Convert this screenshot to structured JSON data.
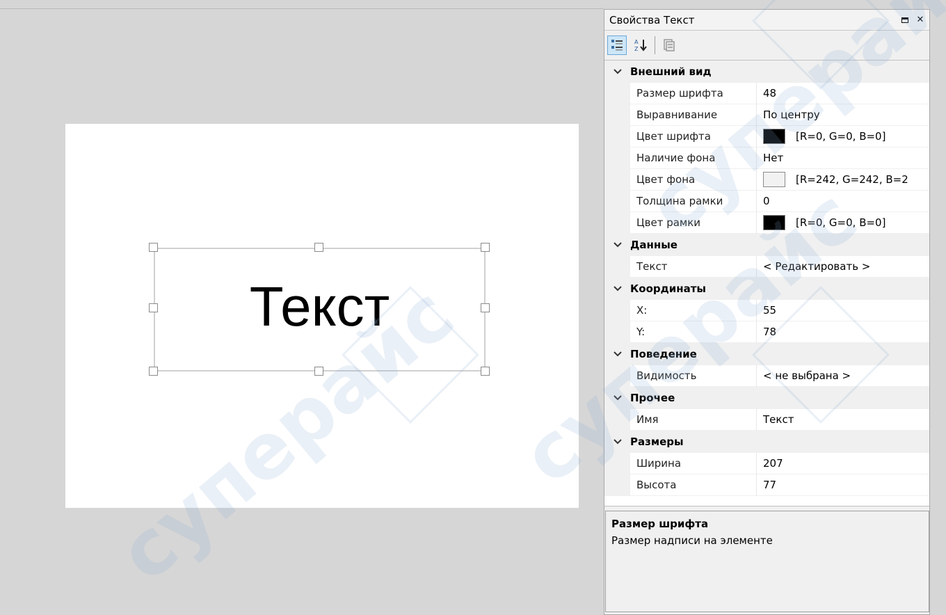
{
  "canvas": {
    "element_text": "Текст"
  },
  "panel": {
    "title": "Свойства Текст",
    "toolbar": {
      "categorized_icon": "categorized-view-icon",
      "alphabetical_icon": "sort-alpha-icon",
      "property_pages_icon": "property-pages-icon"
    },
    "categories": [
      {
        "label": "Внешний вид",
        "props": [
          {
            "name": "Размер шрифта",
            "value": "48"
          },
          {
            "name": "Выравнивание",
            "value": "По центру"
          },
          {
            "name": "Цвет шрифта",
            "value": "[R=0, G=0, B=0]",
            "swatch": "#000000"
          },
          {
            "name": "Наличие фона",
            "value": "Нет"
          },
          {
            "name": "Цвет фона",
            "value": "[R=242, G=242, B=2",
            "swatch": "#f2f2f2"
          },
          {
            "name": "Толщина рамки",
            "value": "0"
          },
          {
            "name": "Цвет рамки",
            "value": "[R=0, G=0, B=0]",
            "swatch": "#000000"
          }
        ]
      },
      {
        "label": "Данные",
        "props": [
          {
            "name": "Текст",
            "value": "< Редактировать >"
          }
        ]
      },
      {
        "label": "Координаты",
        "props": [
          {
            "name": "X:",
            "value": "55"
          },
          {
            "name": "Y:",
            "value": "78"
          }
        ]
      },
      {
        "label": "Поведение",
        "props": [
          {
            "name": "Видимость",
            "value": "< не выбрана >"
          }
        ]
      },
      {
        "label": "Прочее",
        "props": [
          {
            "name": "Имя",
            "value": "Текст"
          }
        ]
      },
      {
        "label": "Размеры",
        "props": [
          {
            "name": "Ширина",
            "value": "207"
          },
          {
            "name": "Высота",
            "value": "77"
          }
        ]
      }
    ],
    "description": {
      "title": "Размер шрифта",
      "text": "Размер надписи на элементе"
    }
  },
  "watermark": {
    "text": "суперайс"
  }
}
